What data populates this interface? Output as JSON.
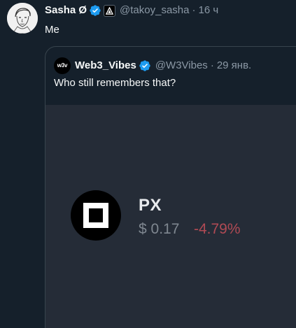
{
  "tweet": {
    "author_name": "Sasha Ø",
    "author_handle": "@takoy_sasha",
    "separator": "·",
    "time": "16 ч",
    "text": "Me"
  },
  "quote": {
    "avatar_text": "w3v",
    "author_name": "Web3_Vibes",
    "author_handle": "@W3Vibes",
    "separator": "·",
    "time": "29 янв.",
    "text": "Who still remembers that?",
    "media": {
      "token_symbol": "PX",
      "price": "$ 0.17",
      "change": "-4.79%"
    }
  },
  "icons": {
    "verified": "verified-badge-icon",
    "affiliate": "affiliate-badge-icon",
    "token": "px-token-icon"
  },
  "colors": {
    "background": "#15202b",
    "verified": "#1d9bf0",
    "negative_change": "#b04a54",
    "secondary_text": "#8b98a5"
  }
}
